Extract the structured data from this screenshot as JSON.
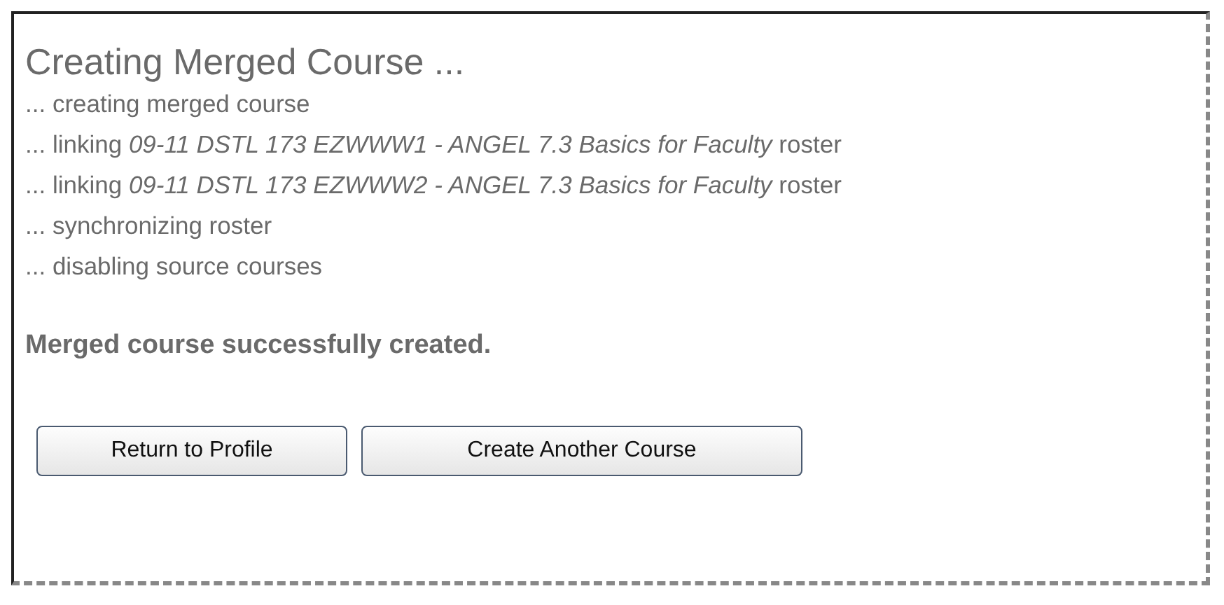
{
  "title": "Creating Merged Course ...",
  "steps": [
    "... creating merged course",
    "... linking *09-11 DSTL 173 EZWWW1 - ANGEL 7.3 Basics for Faculty* roster",
    "... linking *09-11 DSTL 173 EZWWW2 - ANGEL 7.3 Basics for Faculty* roster",
    "... synchronizing roster",
    "... disabling source courses"
  ],
  "result": "Merged course successfully created.",
  "buttons": [
    "Return to Profile",
    "Create Another Course"
  ]
}
